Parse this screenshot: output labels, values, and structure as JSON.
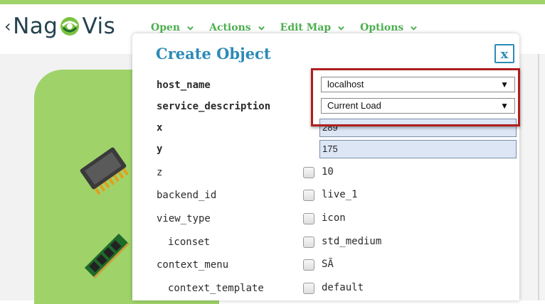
{
  "app": {
    "logo_text_a": "Nag",
    "logo_text_b": "Vis",
    "back_glyph": "‹"
  },
  "menu": {
    "items": [
      {
        "label": "Open"
      },
      {
        "label": "Actions"
      },
      {
        "label": "Edit Map"
      },
      {
        "label": "Options"
      }
    ]
  },
  "dialog": {
    "title": "Create Object",
    "close_label": "x",
    "fields": {
      "host_name": {
        "label": "host_name",
        "value": "localhost"
      },
      "service_description": {
        "label": "service_description",
        "value": "Current Load"
      },
      "x": {
        "label": "x",
        "value": "289"
      },
      "y": {
        "label": "y",
        "value": "175"
      },
      "z": {
        "label": "z",
        "default": "10"
      },
      "backend_id": {
        "label": "backend_id",
        "default": "live_1"
      },
      "view_type": {
        "label": "view_type",
        "default": "icon"
      },
      "iconset": {
        "label": "iconset",
        "default": "std_medium"
      },
      "context_menu": {
        "label": "context_menu",
        "default": "SÃ"
      },
      "context_template": {
        "label": "context_template",
        "default": "default"
      }
    }
  },
  "colors": {
    "accent_green": "#9fd36a",
    "menu_green": "#4caf50",
    "title_blue": "#2d8bb6",
    "highlight_red": "#b01e1e"
  }
}
